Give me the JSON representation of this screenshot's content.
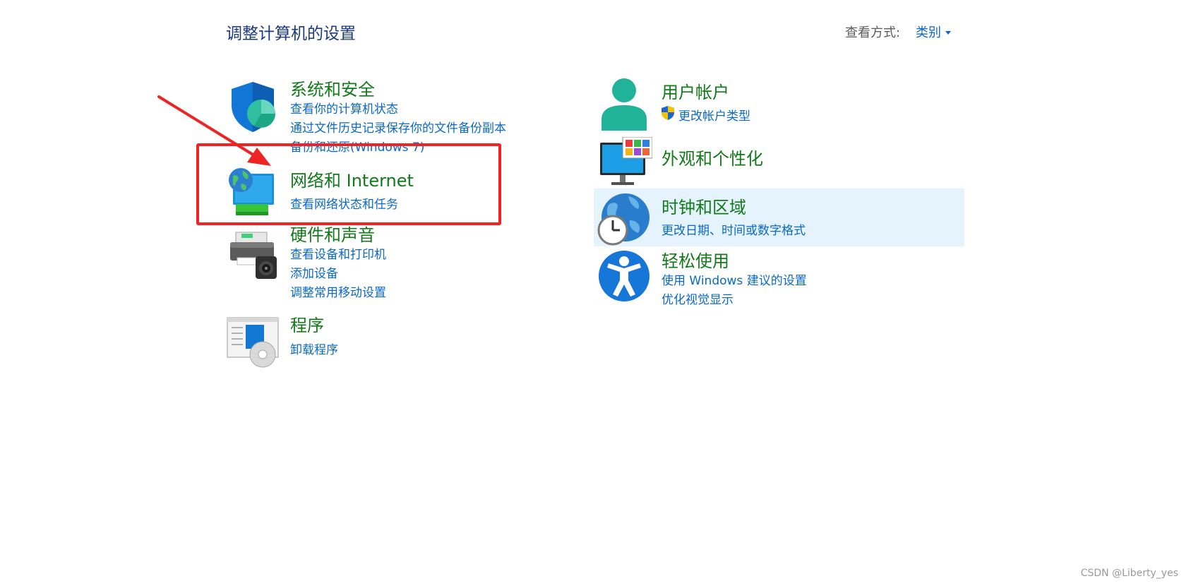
{
  "header": {
    "page_title": "调整计算机的设置",
    "view_label": "查看方式:",
    "view_value": "类别"
  },
  "categories": {
    "system": {
      "title": "系统和安全",
      "links": [
        "查看你的计算机状态",
        "通过文件历史记录保存你的文件备份副本",
        "备份和还原(Windows 7)"
      ],
      "icon": "shield-icon"
    },
    "network": {
      "title": "网络和 Internet",
      "links": [
        "查看网络状态和任务"
      ],
      "icon": "network-globe-icon"
    },
    "hardware": {
      "title": "硬件和声音",
      "links": [
        "查看设备和打印机",
        "添加设备",
        "调整常用移动设置"
      ],
      "icon": "printer-icon"
    },
    "programs": {
      "title": "程序",
      "links": [
        "卸载程序"
      ],
      "icon": "programs-disc-icon"
    },
    "user": {
      "title": "用户帐户",
      "links": [
        "更改帐户类型"
      ],
      "icon": "user-icon"
    },
    "appearance": {
      "title": "外观和个性化",
      "links": [],
      "icon": "monitor-palette-icon"
    },
    "clock": {
      "title": "时钟和区域",
      "links": [
        "更改日期、时间或数字格式"
      ],
      "icon": "globe-clock-icon"
    },
    "ease": {
      "title": "轻松使用",
      "links": [
        "使用 Windows 建议的设置",
        "优化视觉显示"
      ],
      "icon": "accessibility-icon"
    }
  },
  "colors": {
    "category_title": "#137a1a",
    "link": "#0a68c8",
    "page_title": "#1b3a80",
    "annotation_red": "#ee2424",
    "hover_bg": "#e5f3fd"
  },
  "watermark": "CSDN @Liberty_yes"
}
